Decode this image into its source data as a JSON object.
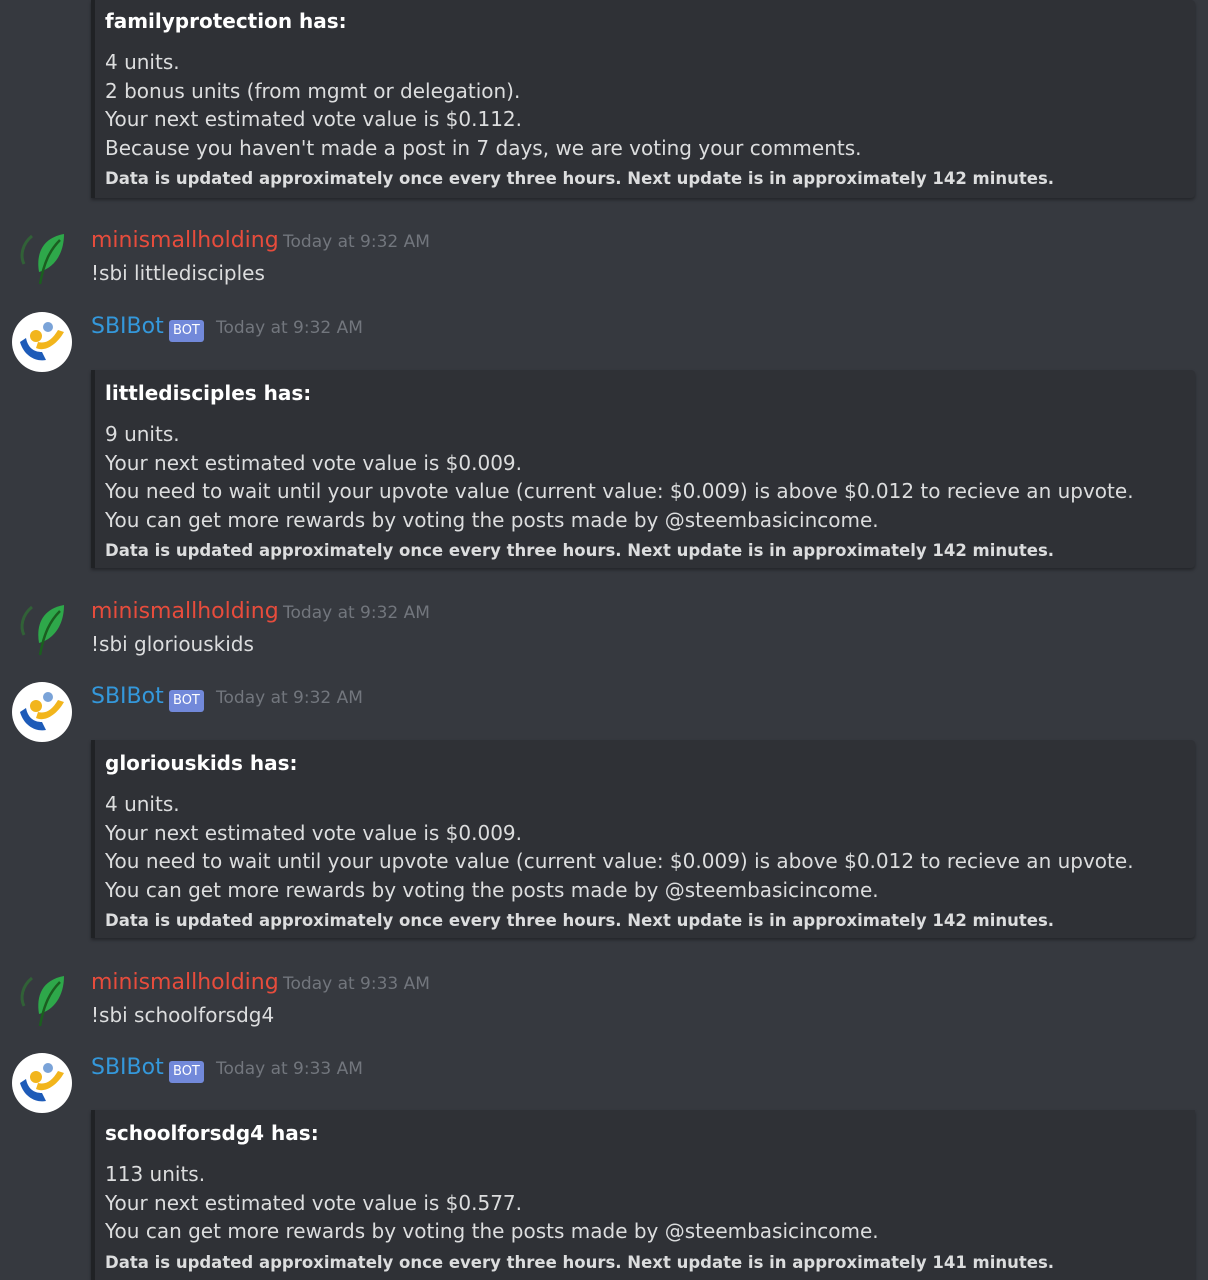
{
  "embeds": [
    {
      "title": "familyprotection has:",
      "lines": [
        "4 units.",
        "2 bonus units (from mgmt or delegation).",
        "Your next estimated vote value is $0.112.",
        "Because you haven't made a post in 7 days, we are voting your comments."
      ],
      "footer": "Data is updated approximately once every three hours. Next update is in approximately 142 minutes."
    },
    {
      "title": "littledisciples has:",
      "lines": [
        "9 units.",
        "Your next estimated vote value is $0.009.",
        "You need to wait until your upvote value (current value: $0.009) is above $0.012 to recieve an upvote.",
        "You can get more rewards by voting the posts made by @steembasicincome."
      ],
      "footer": "Data is updated approximately once every three hours. Next update is in approximately 142 minutes."
    },
    {
      "title": "gloriouskids has:",
      "lines": [
        "4 units.",
        "Your next estimated vote value is $0.009.",
        "You need to wait until your upvote value (current value: $0.009) is above $0.012 to recieve an upvote.",
        "You can get more rewards by voting the posts made by @steembasicincome."
      ],
      "footer": "Data is updated approximately once every three hours. Next update is in approximately 142 minutes."
    },
    {
      "title": "schoolforsdg4 has:",
      "lines": [
        "113 units.",
        "Your next estimated vote value is $0.577.",
        "You can get more rewards by voting the posts made by @steembasicincome."
      ],
      "footer": "Data is updated approximately once every three hours. Next update is in approximately 141 minutes."
    }
  ],
  "messages": [
    {
      "author": "minismallholding",
      "timestamp": "Today at 9:32 AM",
      "content": "!sbi littledisciples",
      "avatar_icon": "leaf-icon"
    },
    {
      "author": "SBIBot",
      "bot_tag": "BOT",
      "timestamp": "Today at 9:32 AM",
      "avatar_icon": "sbi-hands-icon"
    },
    {
      "author": "minismallholding",
      "timestamp": "Today at 9:32 AM",
      "content": "!sbi gloriouskids",
      "avatar_icon": "leaf-icon"
    },
    {
      "author": "SBIBot",
      "bot_tag": "BOT",
      "timestamp": "Today at 9:32 AM",
      "avatar_icon": "sbi-hands-icon"
    },
    {
      "author": "minismallholding",
      "timestamp": "Today at 9:33 AM",
      "content": "!sbi schoolforsdg4",
      "avatar_icon": "leaf-icon"
    },
    {
      "author": "SBIBot",
      "bot_tag": "BOT",
      "timestamp": "Today at 9:33 AM",
      "avatar_icon": "sbi-hands-icon"
    }
  ],
  "colors": {
    "background": "#36393f",
    "embed_background": "#2f3136",
    "user_name": "#e74c3c",
    "bot_name": "#3498db",
    "bot_tag": "#7289da",
    "timestamp": "#72767d"
  }
}
